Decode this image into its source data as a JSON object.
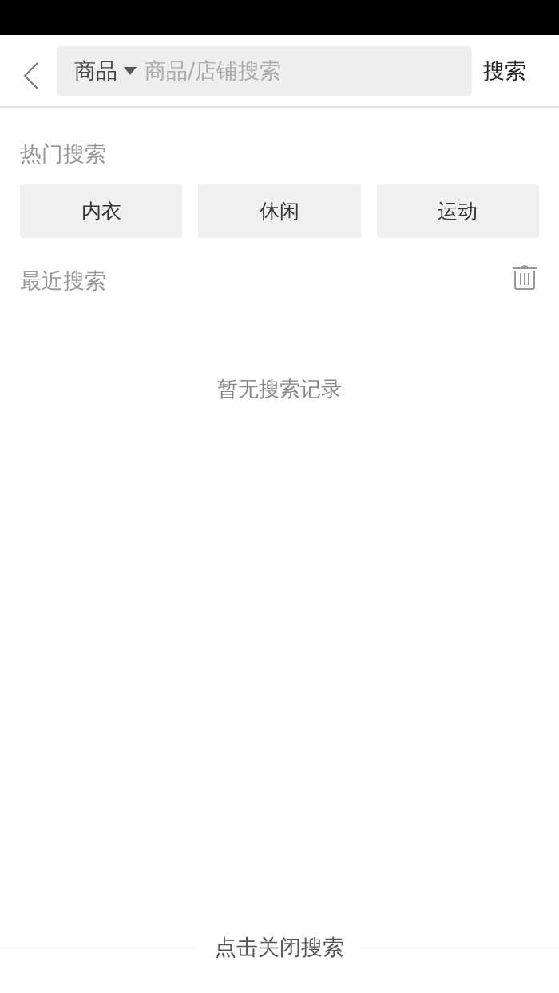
{
  "search_bar": {
    "category": "商品",
    "placeholder": "商品/店铺搜索",
    "submit": "搜索"
  },
  "hot_searches": {
    "title": "热门搜索",
    "tags": [
      "内衣",
      "休闲",
      "运动"
    ]
  },
  "recent_searches": {
    "title": "最近搜索",
    "empty_text": "暂无搜索记录"
  },
  "footer": {
    "close_label": "点击关闭搜索"
  }
}
